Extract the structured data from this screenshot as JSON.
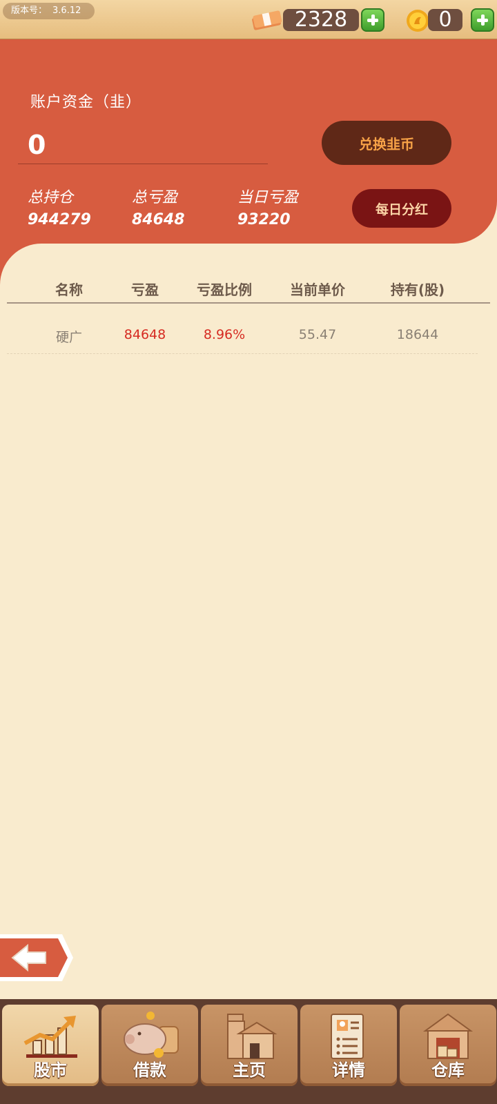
{
  "header": {
    "version_label": "版本号：",
    "version_value": "3.6.12",
    "cash_amount": "2328",
    "coin_amount": "0"
  },
  "account": {
    "title": "账户资金（韭）",
    "value": "0",
    "exchange_button": "兑换韭币",
    "dividend_button": "每日分红",
    "stats": [
      {
        "label": "总持仓",
        "value": "944279"
      },
      {
        "label": "总亏盈",
        "value": "84648"
      },
      {
        "label": "当日亏盈",
        "value": "93220"
      }
    ]
  },
  "table": {
    "headers": [
      "名称",
      "亏盈",
      "亏盈比例",
      "当前单价",
      "持有(股)"
    ],
    "rows": [
      {
        "name": "硬广",
        "profit": "84648",
        "ratio": "8.96%",
        "price": "55.47",
        "shares": "18644"
      }
    ]
  },
  "nav": {
    "items": [
      {
        "label": "股市",
        "icon": "stock-chart-icon"
      },
      {
        "label": "借款",
        "icon": "piggy-bank-icon"
      },
      {
        "label": "主页",
        "icon": "house-icon"
      },
      {
        "label": "详情",
        "icon": "resume-icon"
      },
      {
        "label": "仓库",
        "icon": "warehouse-icon"
      }
    ],
    "active": "股市"
  },
  "colors": {
    "panel": "#d75c40",
    "background": "#f9ebce",
    "loss_profit_red": "#d62b22"
  }
}
